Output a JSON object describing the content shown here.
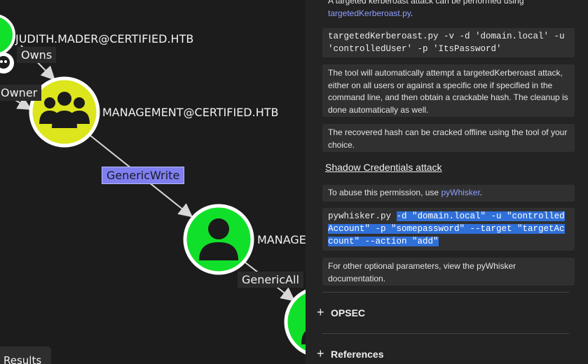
{
  "graph": {
    "nodes": {
      "judith": "JUDITH.MADER@CERTIFIED.HTB",
      "management_group": "MANAGEMENT@CERTIFIED.HTB",
      "management_user": "MANAGE"
    },
    "edges": {
      "owns": "Owns",
      "owner": "Owner",
      "generic_write": "GenericWrite",
      "generic_all": "GenericAll"
    },
    "results_tab": "Results"
  },
  "panel": {
    "intro_text": "A targeted kerberoast attack can be performed using",
    "intro_link": "targetedKerberoast.py",
    "intro_period": ".",
    "kerberoast_command": "targetedKerberoast.py -v -d 'domain.local' -u 'controlledUser' -p 'ItsPassword'",
    "tool_description": "The tool will automatically attempt a targetedKerberoast attack, either on all users or against a specific one if specified in the command line, and then obtain a crackable hash. The cleanup is done automatically as well.",
    "recovered_hash_text": "The recovered hash can be cracked offline using the tool of your choice.",
    "shadow_credentials_heading": "Shadow Credentials attack",
    "abuse_text": "To abuse this permission, use",
    "abuse_link": "pyWhisker",
    "abuse_period": ".",
    "pywhisker_cmd_start": "pywhisker.py ",
    "pywhisker_cmd_selected": "-d \"domain.local\" -u \"controlledAccount\" -p \"somepassword\" --target \"targetAccount\" --action \"add\"",
    "other_params_text": "For other optional parameters, view the pyWhisker documentation.",
    "sections": [
      {
        "label": "OPSEC",
        "icon": "plus-icon"
      },
      {
        "label": "References",
        "icon": "plus-icon"
      }
    ]
  },
  "colors": {
    "node_green": "#11e02a",
    "group_yellow": "#dde51c",
    "selected_edge": "#7f7ff0",
    "link": "#8e9fff",
    "selection_highlight": "#2f6fd8"
  }
}
